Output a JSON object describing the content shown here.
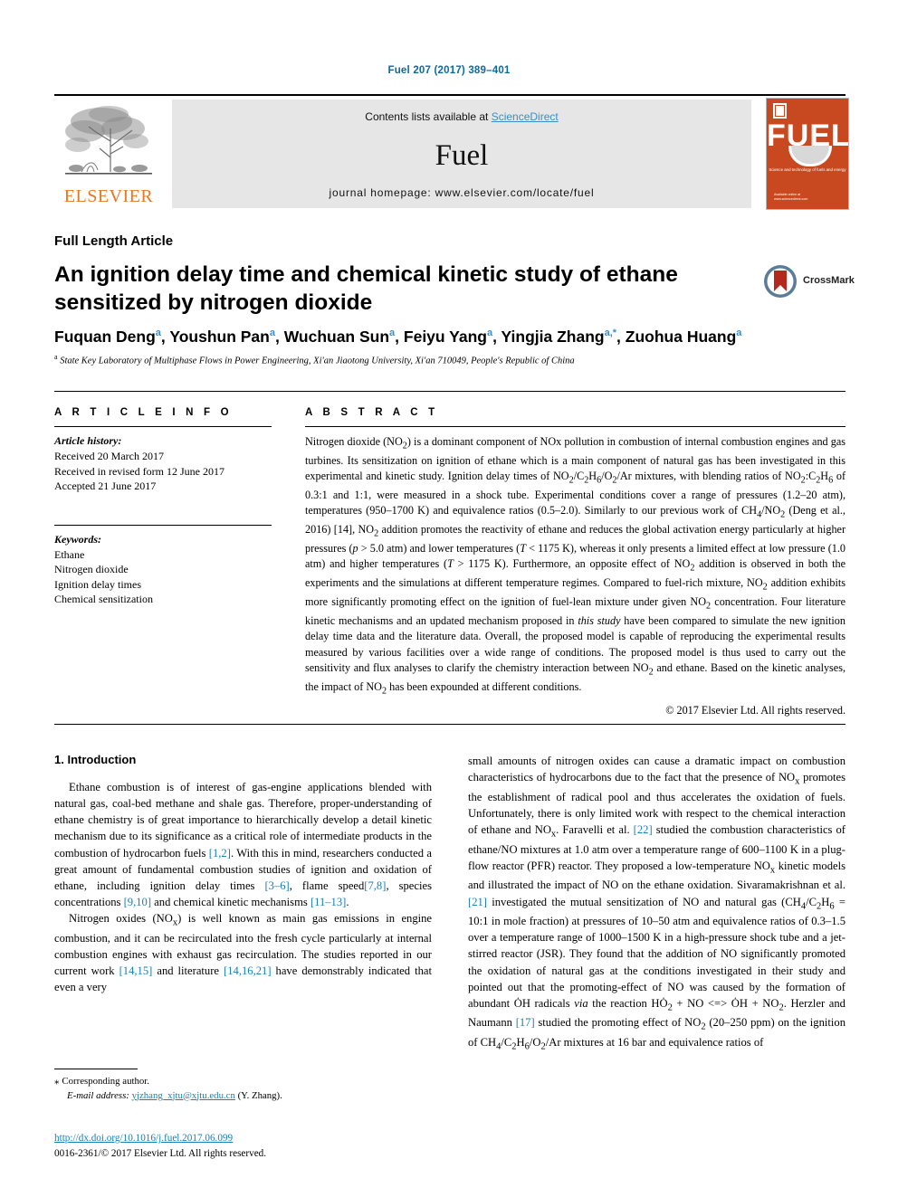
{
  "running_head": "Fuel 207 (2017) 389–401",
  "masthead": {
    "contents_prefix": "Contents lists available at ",
    "sciencedirect": "ScienceDirect",
    "journal_name": "Fuel",
    "homepage": "journal homepage: www.elsevier.com/locate/fuel",
    "publisher_wordmark": "ELSEVIER",
    "cover": {
      "title": "FUEL",
      "subtitle": "Science and technology of fuels and energy",
      "footer": "Available online at www.sciencedirect.com"
    }
  },
  "article": {
    "type": "Full Length Article",
    "title": "An ignition delay time and chemical kinetic study of ethane sensitized by nitrogen dioxide",
    "crossmark_label": "CrossMark",
    "authors_html": "Fuquan Deng<sup>a</sup>, Youshun Pan<sup>a</sup>, Wuchuan Sun<sup>a</sup>, Feiyu Yang<sup>a</sup>, Yingjia Zhang<sup>a,*</sup>, Zuohua Huang<sup>a</sup>",
    "affiliation_html": "<sup>a</sup> State Key Laboratory of Multiphase Flows in Power Engineering, Xi'an Jiaotong University, Xi'an 710049, People's Republic of China"
  },
  "info": {
    "heading": "A R T I C L E   I N F O",
    "history_heading": "Article history:",
    "history": [
      "Received 20 March 2017",
      "Received in revised form 12 June 2017",
      "Accepted 21 June 2017"
    ],
    "keywords_heading": "Keywords:",
    "keywords": [
      "Ethane",
      "Nitrogen dioxide",
      "Ignition delay times",
      "Chemical sensitization"
    ]
  },
  "abstract": {
    "heading": "A B S T R A C T",
    "body_html": "Nitrogen dioxide (NO<sub>2</sub>) is a dominant component of NOx pollution in combustion of internal combustion engines and gas turbines. Its sensitization on ignition of ethane which is a main component of natural gas has been investigated in this experimental and kinetic study. Ignition delay times of NO<sub>2</sub>/C<sub>2</sub>H<sub>6</sub>/O<sub>2</sub>/Ar mixtures, with blending ratios of NO<sub>2</sub>:C<sub>2</sub>H<sub>6</sub> of 0.3:1 and 1:1, were measured in a shock tube. Experimental conditions cover a range of pressures (1.2–20 atm), temperatures (950–1700 K) and equivalence ratios (0.5–2.0). Similarly to our previous work of CH<sub>4</sub>/NO<sub>2</sub> (Deng et al., 2016) [14], NO<sub>2</sub> addition promotes the reactivity of ethane and reduces the global activation energy particularly at higher pressures (<i>p</i> &gt; 5.0 atm) and lower temperatures (<i>T</i> &lt; 1175 K), whereas it only presents a limited effect at low pressure (1.0 atm) and higher temperatures (<i>T</i> &gt; 1175 K). Furthermore, an opposite effect of NO<sub>2</sub> addition is observed in both the experiments and the simulations at different temperature regimes. Compared to fuel-rich mixture, NO<sub>2</sub> addition exhibits more significantly promoting effect on the ignition of fuel-lean mixture under given NO<sub>2</sub> concentration. Four literature kinetic mechanisms and an updated mechanism proposed in <i>this study</i> have been compared to simulate the new ignition delay time data and the literature data. Overall, the proposed model is capable of reproducing the experimental results measured by various facilities over a wide range of conditions. The proposed model is thus used to carry out the sensitivity and flux analyses to clarify the chemistry interaction between NO<sub>2</sub> and ethane. Based on the kinetic analyses, the impact of NO<sub>2</sub> has been expounded at different conditions.",
    "copyright": "© 2017 Elsevier Ltd. All rights reserved."
  },
  "body": {
    "section_heading": "1. Introduction",
    "left_paragraphs_html": [
      "Ethane combustion is of interest of gas-engine applications blended with natural gas, coal-bed methane and shale gas. Therefore, proper-understanding of ethane chemistry is of great importance to hierarchically develop a detail kinetic mechanism due to its significance as a critical role of intermediate products in the combustion of hydrocarbon fuels <span class=\"ref\">[1,2]</span>. With this in mind, researchers conducted a great amount of fundamental combustion studies of ignition and oxidation of ethane, including ignition delay times <span class=\"ref\">[3–6]</span>, flame speed<span class=\"ref\">[7,8]</span>, species concentrations <span class=\"ref\">[9,10]</span> and chemical kinetic mechanisms <span class=\"ref\">[11–13]</span>.",
      "Nitrogen oxides (NO<sub>x</sub>) is well known as main gas emissions in engine combustion, and it can be recirculated into the fresh cycle particularly at internal combustion engines with exhaust gas recirculation. The studies reported in our current work <span class=\"ref\">[14,15]</span> and literature <span class=\"ref\">[14,16,21]</span> have demonstrably indicated that even a very"
    ],
    "right_paragraphs_html": [
      "small amounts of nitrogen oxides can cause a dramatic impact on combustion characteristics of hydrocarbons due to the fact that the presence of NO<sub>x</sub> promotes the establishment of radical pool and thus accelerates the oxidation of fuels. Unfortunately, there is only limited work with respect to the chemical interaction of ethane and NO<sub>x</sub>. Faravelli et al. <span class=\"ref\">[22]</span> studied the combustion characteristics of ethane/NO mixtures at 1.0 atm over a temperature range of 600–1100 K in a plug-flow reactor (PFR) reactor. They proposed a low-temperature NO<sub>x</sub> kinetic models and illustrated the impact of NO on the ethane oxidation. Sivaramakrishnan et al. <span class=\"ref\">[21]</span> investigated the mutual sensitization of NO and natural gas (CH<sub>4</sub>/C<sub>2</sub>H<sub>6</sub> = 10:1 in mole fraction) at pressures of 10–50 atm and equivalence ratios of 0.3–1.5 over a temperature range of 1000–1500 K in a high-pressure shock tube and a jet-stirred reactor (JSR). They found that the addition of NO significantly promoted the oxidation of natural gas at the conditions investigated in their study and pointed out that the promoting-effect of NO was caused by the formation of abundant ȮH radicals <i>via</i> the reaction HȮ<sub>2</sub> + NO &lt;=&gt; ȮH + NO<sub>2</sub>. Herzler and Naumann <span class=\"ref\">[17]</span> studied the promoting effect of NO<sub>2</sub> (20–250 ppm) on the ignition of CH<sub>4</sub>/C<sub>2</sub>H<sub>6</sub>/O<sub>2</sub>/Ar mixtures at 16 bar and equivalence ratios of"
    ]
  },
  "footnotes": {
    "corresponding_marker": "⁎",
    "corresponding_text": "Corresponding author.",
    "email_label": "E-mail address:",
    "email": "yjzhang_xjtu@xjtu.edu.cn",
    "email_suffix": "(Y. Zhang)."
  },
  "footer": {
    "doi": "http://dx.doi.org/10.1016/j.fuel.2017.06.099",
    "issn_line": "0016-2361/© 2017 Elsevier Ltd. All rights reserved."
  },
  "colors": {
    "link_blue": "#1a7fb5",
    "elsevier_orange": "#e87722",
    "cover_orange": "#c8481f",
    "band_gray": "#e6e6e6"
  }
}
